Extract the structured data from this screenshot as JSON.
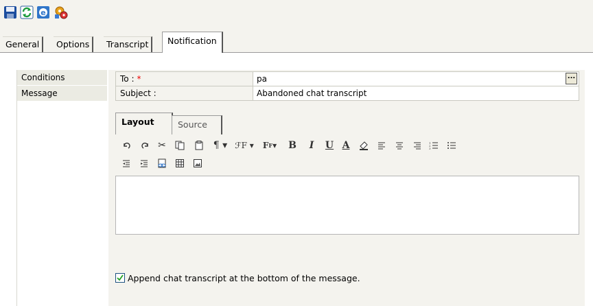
{
  "toolbar": {
    "buttons": [
      "save-icon",
      "refresh-icon",
      "browser-icon",
      "settings-icon"
    ]
  },
  "tabs": [
    {
      "label": "General"
    },
    {
      "label": "Options"
    },
    {
      "label": "Transcript"
    },
    {
      "label": "Notification",
      "active": true
    }
  ],
  "sidebar": {
    "items": [
      {
        "label": "Conditions"
      },
      {
        "label": "Message"
      }
    ]
  },
  "form": {
    "to_label": "To :",
    "to_required": "*",
    "to_value": "pa",
    "browse_label": "...",
    "subject_label": "Subject :",
    "subject_value": "Abandoned chat transcript"
  },
  "editor": {
    "tabs": [
      {
        "label": "Layout",
        "active": true
      },
      {
        "label": "Source"
      }
    ],
    "format_buttons": [
      "undo-icon",
      "redo-icon",
      "cut-icon",
      "copy-icon",
      "paste-icon",
      "paragraph-icon",
      "font-family-icon",
      "font-size-icon",
      "bold-icon",
      "italic-icon",
      "underline-icon",
      "font-color-icon",
      "highlight-icon",
      "align-left-icon",
      "align-center-icon",
      "align-right-icon",
      "ordered-list-icon",
      "unordered-list-icon",
      "outdent-icon",
      "indent-icon",
      "link-icon",
      "table-icon",
      "image-icon"
    ],
    "body": ""
  },
  "append": {
    "checked": true,
    "label": "Append chat transcript at the bottom of the message."
  }
}
